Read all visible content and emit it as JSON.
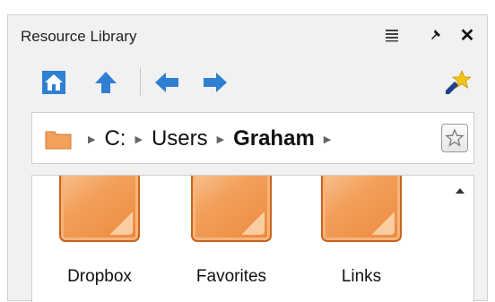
{
  "panel": {
    "title": "Resource Library"
  },
  "toolbar": {
    "home_icon": "home-icon",
    "up_icon": "up-arrow-icon",
    "back_icon": "back-arrow-icon",
    "forward_icon": "forward-arrow-icon",
    "pin_icon": "pin-star-icon"
  },
  "path": {
    "segments": [
      "C:",
      "Users",
      "Graham"
    ]
  },
  "items": [
    {
      "label": "Dropbox"
    },
    {
      "label": "Favorites"
    },
    {
      "label": "Links"
    }
  ],
  "colors": {
    "accent": "#2f7fd3",
    "folder": "#f2a05c"
  }
}
